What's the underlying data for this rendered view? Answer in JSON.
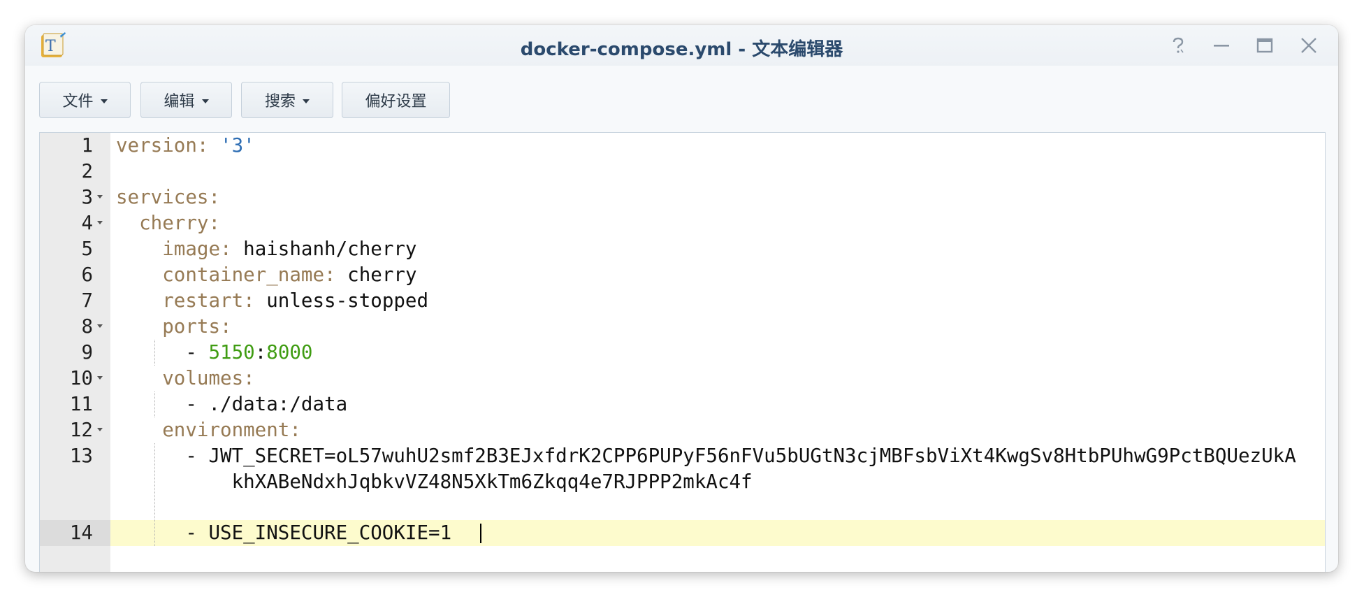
{
  "window": {
    "title": "docker-compose.yml - 文本编辑器",
    "app_icon_letter": "T"
  },
  "toolbar": {
    "file_label": "文件",
    "edit_label": "编辑",
    "search_label": "搜索",
    "prefs_label": "偏好设置"
  },
  "editor": {
    "line_numbers": [
      "1",
      "2",
      "3",
      "4",
      "5",
      "6",
      "7",
      "8",
      "9",
      "10",
      "11",
      "12",
      "13",
      "14"
    ],
    "current_line": 14,
    "lines": {
      "l1_key": "version:",
      "l1_val": "'3'",
      "l3_key": "services:",
      "l4_key": "cherry:",
      "l5_key": "image:",
      "l5_val": "haishanh/cherry",
      "l6_key": "container_name:",
      "l6_val": "cherry",
      "l7_key": "restart:",
      "l7_val": "unless-stopped",
      "l8_key": "ports:",
      "l9_dash": "-",
      "l9_host": "5150",
      "l9_sep": ":",
      "l9_container": "8000",
      "l10_key": "volumes:",
      "l11_val": "- ./data:/data",
      "l12_key": "environment:",
      "l13_val_a": "- JWT_SECRET=oL57wuhU2smf2B3EJxfdrK2CPP6PUPyF56nFVu5bUGtN3cjMBFsbViXt4KwgSv8HtbPUhwG9PctBQUezUkA",
      "l13_val_b": "khXABeNdxhJqbkvVZ48N5XkTm6Zkqq4e7RJPPP2mkAc4f",
      "l14_val": "- USE_INSECURE_COOKIE=1"
    }
  },
  "colors": {
    "key": "#967a54",
    "string": "#2d6db3",
    "number": "#3f9c12",
    "active_line": "#fdfbcd"
  }
}
